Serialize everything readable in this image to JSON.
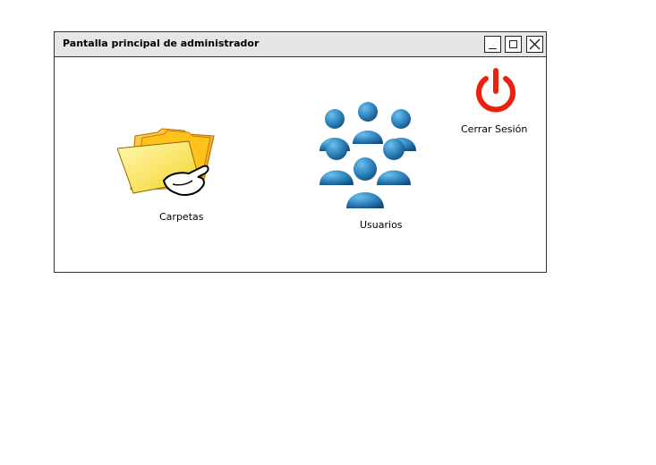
{
  "window": {
    "title": "Pantalla principal de administrador",
    "controls": [
      "minimize",
      "maximize",
      "close"
    ]
  },
  "launchers": {
    "folders": {
      "label": "Carpetas",
      "icon": "folder-hand-icon"
    },
    "users": {
      "label": "Usuarios",
      "icon": "users-group-icon"
    },
    "logout": {
      "label": "Cerrar Sesión",
      "icon": "power-icon"
    }
  },
  "colors": {
    "titlebar": "#e6e6e6",
    "folder": "#ffd84a",
    "users": "#2a7db8",
    "power": "#e8220f"
  }
}
